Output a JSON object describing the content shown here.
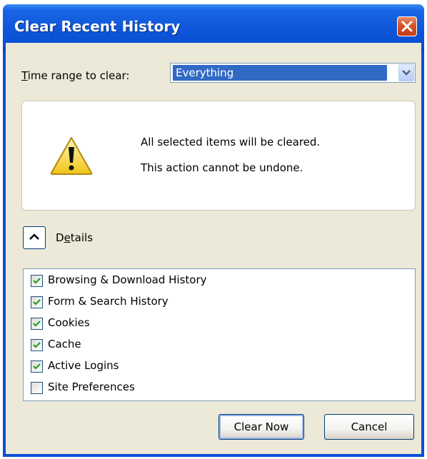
{
  "window": {
    "title": "Clear Recent History",
    "title_color": "#ffffff",
    "titlebar_color": "#0a4fd6"
  },
  "time_range": {
    "label_prefix": "",
    "label_mnemonic": "T",
    "label_rest": "ime range to clear:",
    "selected": "Everything"
  },
  "warning": {
    "icon": "warning-icon",
    "line1": "All selected items will be cleared.",
    "line2": "This action cannot be undone."
  },
  "details": {
    "label_pre": "D",
    "label_mnemonic": "e",
    "label_rest": "tails",
    "toggle_icon": "chevron-up-icon",
    "expanded": true
  },
  "items": [
    {
      "label": "Browsing & Download History",
      "checked": true
    },
    {
      "label": "Form & Search History",
      "checked": true
    },
    {
      "label": "Cookies",
      "checked": true
    },
    {
      "label": "Cache",
      "checked": true
    },
    {
      "label": "Active Logins",
      "checked": true
    },
    {
      "label": "Site Preferences",
      "checked": false
    }
  ],
  "buttons": {
    "clear_now": "Clear Now",
    "cancel": "Cancel"
  },
  "colors": {
    "accent_selection": "#316ac5",
    "close_button": "#d9532c",
    "check_mark": "#21a121"
  }
}
